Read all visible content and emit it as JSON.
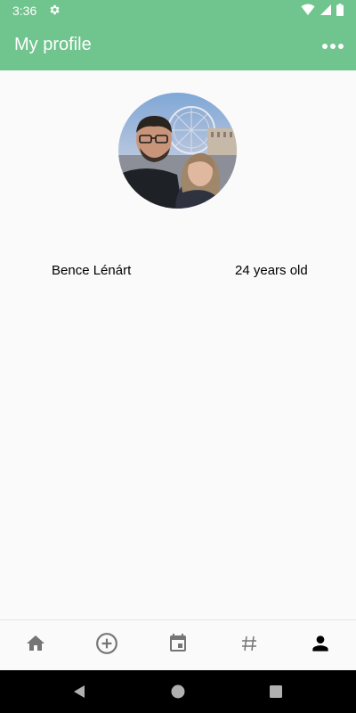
{
  "status_bar": {
    "time": "3:36",
    "icons": [
      "gear-icon",
      "wifi-icon",
      "signal-icon",
      "battery-icon"
    ]
  },
  "app_bar": {
    "title": "My profile",
    "menu_icon": "more-horizontal-icon"
  },
  "profile": {
    "avatar_icon": "profile-photo",
    "name": "Bence Lénárt",
    "age": "24 years old"
  },
  "bottom_nav": {
    "items": [
      {
        "icon": "home-icon",
        "active": false
      },
      {
        "icon": "add-circle-icon",
        "active": false
      },
      {
        "icon": "calendar-icon",
        "active": false
      },
      {
        "icon": "hashtag-icon",
        "active": false
      },
      {
        "icon": "person-icon",
        "active": true
      }
    ]
  },
  "system_nav": {
    "icons": [
      "back-icon",
      "home-circle-icon",
      "recents-icon"
    ]
  },
  "colors": {
    "primary": "#70c48d",
    "inactive_icon": "#757575",
    "active_icon": "#000000"
  }
}
